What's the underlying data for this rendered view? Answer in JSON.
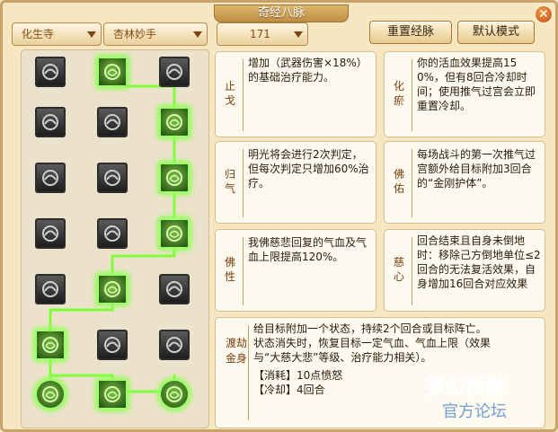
{
  "title": "奇经八脉",
  "close_label": "✕",
  "dropdowns": [
    "化生寺",
    "杏林妙手",
    "171"
  ],
  "buttons": {
    "reset": "重置经脉",
    "default": "默认模式"
  },
  "tree": {
    "nodes": [
      {
        "icon": "lotus-seal-icon",
        "active": false
      },
      {
        "icon": "green-arch-icon",
        "active": true
      },
      {
        "icon": "dark-seal-icon",
        "active": false
      },
      {
        "icon": "lotus-pot-icon",
        "active": false
      },
      {
        "icon": "carved-relief-icon",
        "active": false
      },
      {
        "icon": "green-ring-icon",
        "active": true
      },
      {
        "icon": "pagoda-icon",
        "active": false
      },
      {
        "icon": "dagger-icon",
        "active": false
      },
      {
        "icon": "green-rune-icon",
        "active": true
      },
      {
        "icon": "buddha-icon",
        "active": false
      },
      {
        "icon": "folded-cloth-icon",
        "active": false
      },
      {
        "icon": "green-circle-icon",
        "active": true
      },
      {
        "icon": "feather-icon",
        "active": false
      },
      {
        "icon": "green-cloud-icon",
        "active": true
      },
      {
        "icon": "grass-icon",
        "active": false
      },
      {
        "icon": "green-tree-icon",
        "active": true
      },
      {
        "icon": "swirl-vase-icon",
        "active": false
      },
      {
        "icon": "mask-icon",
        "active": false
      },
      {
        "icon": "green-spiral-left-icon",
        "active": true
      },
      {
        "icon": "green-flame-icon",
        "active": true
      },
      {
        "icon": "green-spiral-right-icon",
        "active": true
      }
    ]
  },
  "cards": [
    {
      "name": "止戈",
      "desc": "增加（武器伤害×18%）的基础治疗能力。"
    },
    {
      "name": "化瘀",
      "desc": "你的活血效果提高150%，但有8回合冷却时间；使用推气过宫会立即重置冷却。"
    },
    {
      "name": "归气",
      "desc": "明光将会进行2次判定，但每次判定只增加60%治疗。"
    },
    {
      "name": "佛佑",
      "desc": "每场战斗的第一次推气过宫额外给目标附加3回合的“金刚护体”。"
    },
    {
      "name": "佛性",
      "desc": "我佛慈悲回复的气血及气血上限提高120%。"
    },
    {
      "name": "慈心",
      "desc": "回合结束且自身未倒地时：移除己方倒地单位≤2回合的无法复活效果，自身增加16回合对应效果"
    }
  ],
  "bottom_card": {
    "name": "渡劫金身",
    "lines": [
      "给目标附加一个状态，持续2个回合或目标阵亡。",
      "状态消失时，恢复目标一定气血、气血上限（效果",
      "与“大慈大悲”等级、治疗能力相关）。",
      "【消耗】10点愤怒",
      "【冷却】4回合"
    ]
  },
  "watermark": {
    "line1": "梦幻西游",
    "line2": "官方论坛"
  },
  "colors": {
    "active_glow": "#9cff6a",
    "node_dark": "#1d1d1c",
    "accent": "#c24d10"
  }
}
